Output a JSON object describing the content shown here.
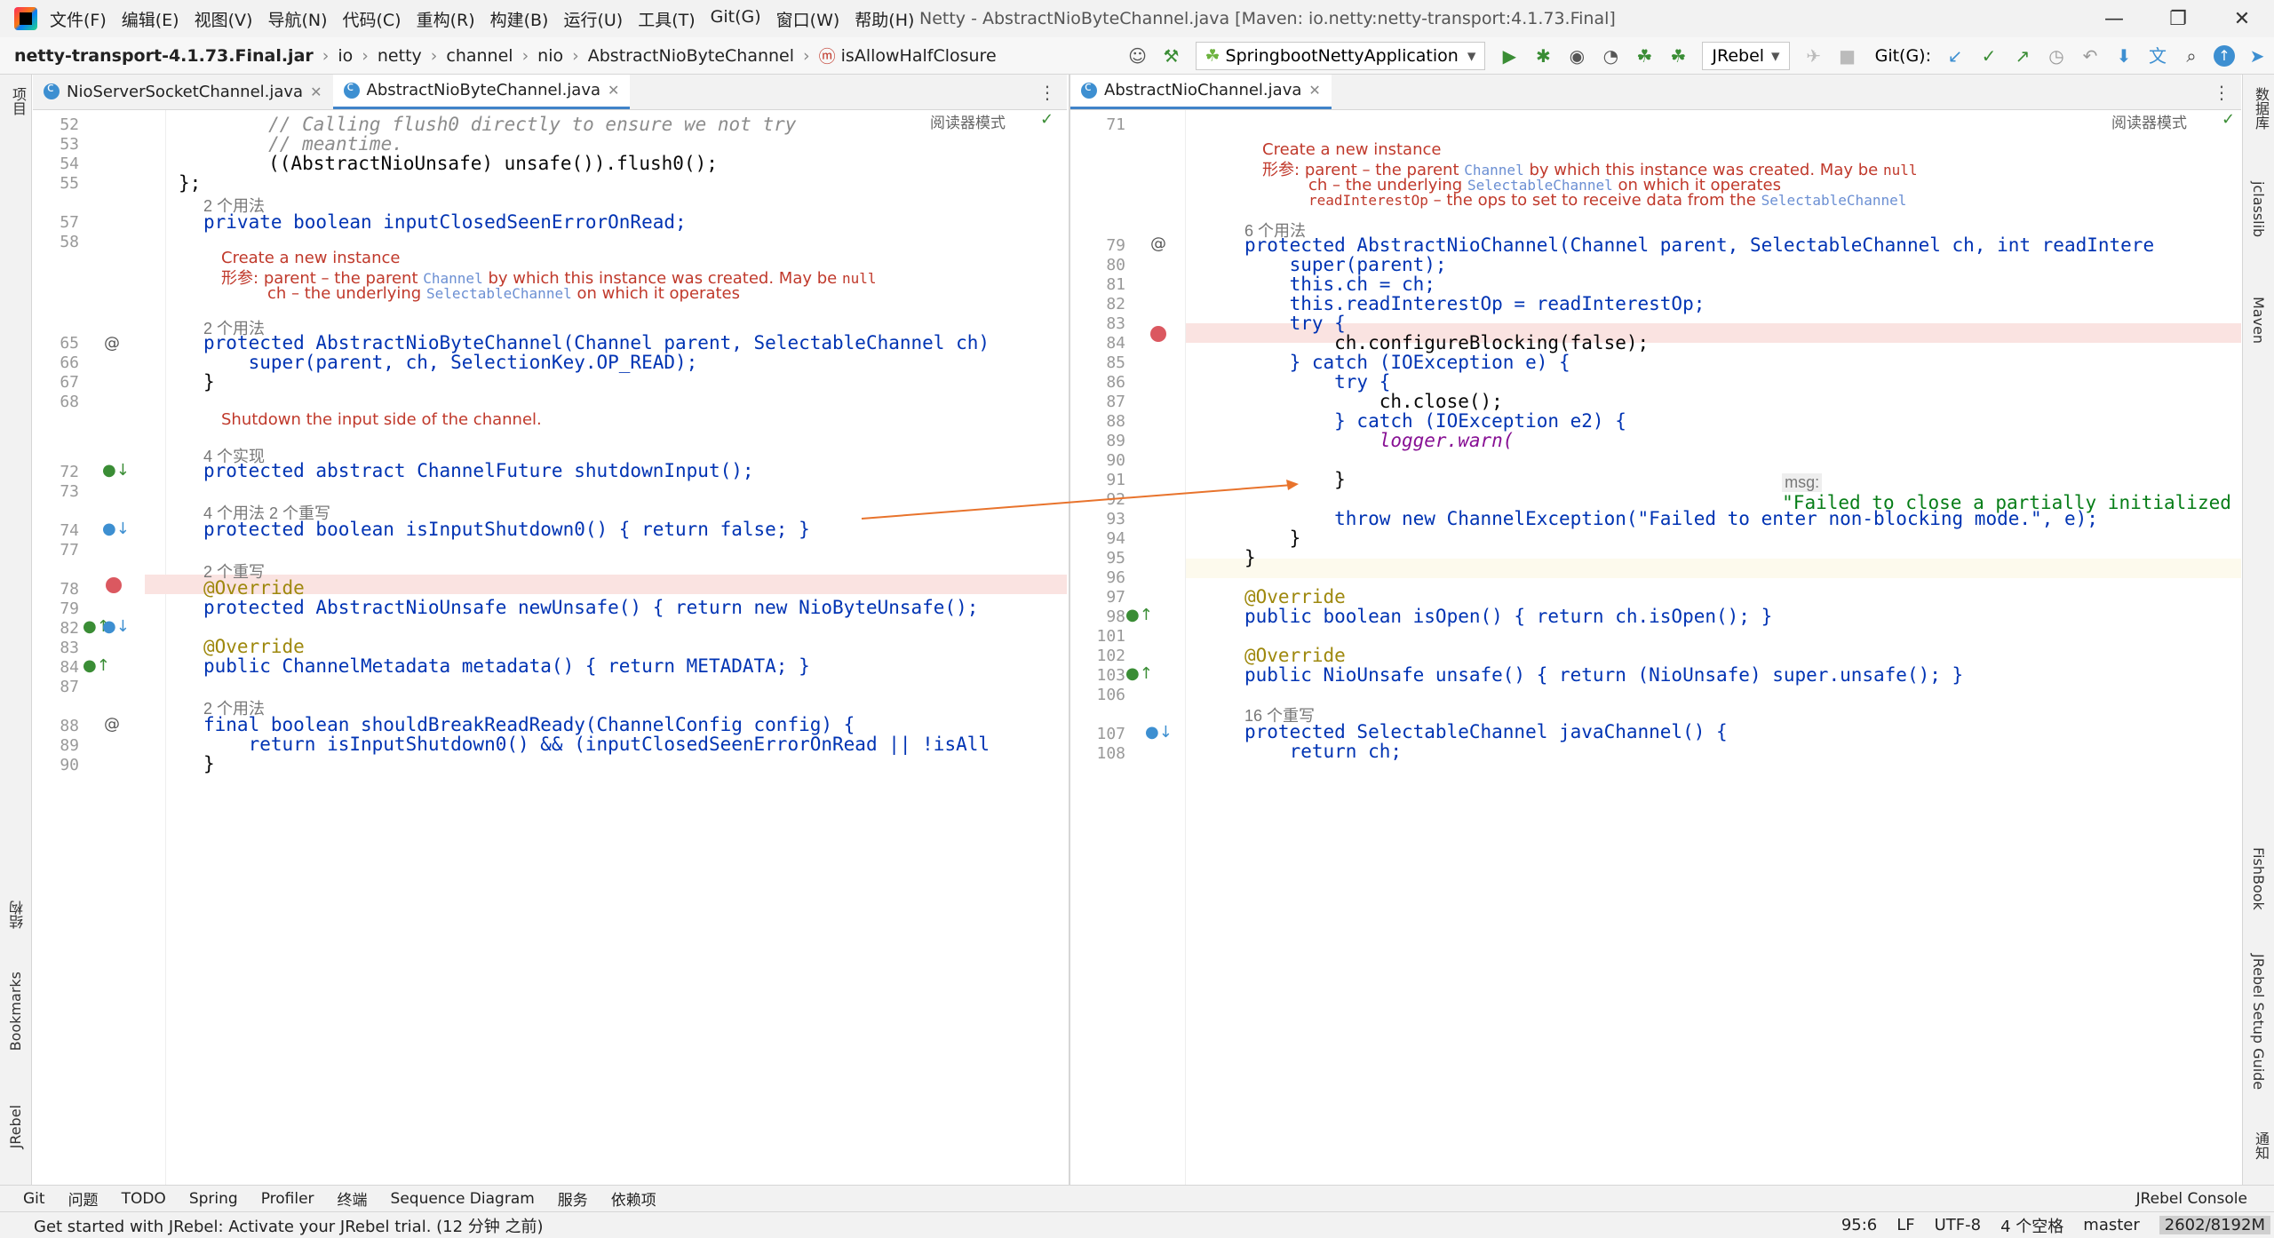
{
  "titlebar": {
    "menus": [
      "文件(F)",
      "编辑(E)",
      "视图(V)",
      "导航(N)",
      "代码(C)",
      "重构(R)",
      "构建(B)",
      "运行(U)",
      "工具(T)",
      "Git(G)",
      "窗口(W)",
      "帮助(H)"
    ],
    "title": "Netty - AbstractNioByteChannel.java [Maven: io.netty:netty-transport:4.1.73.Final]"
  },
  "navbar": {
    "breadcrumb": [
      "netty-transport-4.1.73.Final.jar",
      "io",
      "netty",
      "channel",
      "nio",
      "AbstractNioByteChannel",
      "isAllowHalfClosure"
    ],
    "run_config": "SpringbootNettyApplication",
    "jrebel": "JRebel",
    "git_label": "Git(G):"
  },
  "left_strip": {
    "items": [
      "项目",
      "结构",
      "Bookmarks",
      "JRebel"
    ]
  },
  "right_strip": {
    "items": [
      "数据库",
      "jclasslib",
      "Maven",
      "FishBook",
      "JRebel Setup Guide",
      "通知"
    ]
  },
  "editor_left": {
    "tabs": [
      {
        "label": "NioServerSocketChannel.java",
        "active": false
      },
      {
        "label": "AbstractNioByteChannel.java",
        "active": true
      }
    ],
    "reader_mode": "阅读器模式",
    "line_numbers": [
      "52",
      "53",
      "54",
      "55",
      "57",
      "58",
      "65",
      "66",
      "67",
      "68",
      "72",
      "73",
      "74",
      "77",
      "78",
      "79",
      "82",
      "83",
      "84",
      "87",
      "88",
      "89",
      "90"
    ],
    "code": [
      "        // Calling flush0 directly to ensure we not try",
      "        // meantime.",
      "        ((AbstractNioUnsafe) unsafe()).flush0();",
      "};",
      "private boolean inputClosedSeenErrorOnRead;",
      "protected AbstractNioByteChannel(Channel parent, SelectableChannel ch)",
      "    super(parent, ch, SelectionKey.OP_READ);",
      "}",
      "protected abstract ChannelFuture shutdownInput();",
      "protected boolean isInputShutdown0() { return false; }",
      "@Override",
      "protected AbstractNioUnsafe newUnsafe() { return new NioByteUnsafe();",
      "@Override",
      "public ChannelMetadata metadata() { return METADATA; }",
      "final boolean shouldBreakReadReady(ChannelConfig config) {",
      "    return isInputShutdown0() && (inputClosedSeenErrorOnRead || !isAll",
      "}"
    ],
    "usages": [
      "2 个用法",
      "2 个用法",
      "4 个实现",
      "4 个用法   2 个重写",
      "2 个重写",
      "2 个用法"
    ],
    "doc1": {
      "title": "Create a new instance",
      "param_label": "形参:",
      "p1": "parent – the parent",
      "p1_code": "Channel",
      "p1_tail": "by which this instance was created. May be",
      "p1_null": "null",
      "p2": "ch – the underlying",
      "p2_code": "SelectableChannel",
      "p2_tail": "on which it operates"
    },
    "doc2": {
      "title": "Shutdown the input side of the channel."
    }
  },
  "editor_right": {
    "tabs": [
      {
        "label": "AbstractNioChannel.java",
        "active": true
      }
    ],
    "reader_mode": "阅读器模式",
    "line_numbers": [
      "71",
      "79",
      "80",
      "81",
      "82",
      "83",
      "84",
      "85",
      "86",
      "87",
      "88",
      "89",
      "90",
      "91",
      "92",
      "93",
      "94",
      "95",
      "96",
      "97",
      "98",
      "101",
      "102",
      "103",
      "106",
      "107",
      "108"
    ],
    "code": [
      "protected AbstractNioChannel(Channel parent, SelectableChannel ch, int readIntere",
      "    super(parent);",
      "    this.ch = ch;",
      "    this.readInterestOp = readInterestOp;",
      "    try {",
      "        ch.configureBlocking(false);",
      "    } catch (IOException e) {",
      "        try {",
      "            ch.close();",
      "        } catch (IOException e2) {",
      "            logger.warn(",
      "\"Failed to close a partially initialized socket.\", e",
      "        }",
      "        throw new ChannelException(\"Failed to enter non-blocking mode.\", e);",
      "    }",
      "}",
      "@Override",
      "public boolean isOpen() { return ch.isOpen(); }",
      "@Override",
      "public NioUnsafe unsafe() { return (NioUnsafe) super.unsafe(); }",
      "protected SelectableChannel javaChannel() {",
      "    return ch;"
    ],
    "hint_msg": "msg:",
    "usages": [
      "6 个用法",
      "16 个重写"
    ],
    "doc": {
      "title": "Create a new instance",
      "param_label": "形参:",
      "p1": "parent – the parent",
      "p1_code": "Channel",
      "p1_tail": "by which this instance was created. May be",
      "p1_null": "null",
      "p2": "ch – the underlying",
      "p2_code": "SelectableChannel",
      "p2_tail": "on which it operates",
      "p3_code": "readInterestOp",
      "p3_tail": "– the ops to set to receive data from the",
      "p3_code2": "SelectableChannel"
    }
  },
  "toolwindows": [
    "Git",
    "问题",
    "TODO",
    "Spring",
    "Profiler",
    "终端",
    "Sequence Diagram",
    "服务",
    "依赖项"
  ],
  "toolwindows_right": "JRebel Console",
  "statusbar": {
    "message": "Get started with JRebel: Activate your JRebel trial. (12 分钟 之前)",
    "position": "95:6",
    "line_sep": "LF",
    "encoding": "UTF-8",
    "indent": "4 个空格",
    "branch": "master",
    "memory": "2602/8192M"
  },
  "colors": {
    "breakpoint": "#db5860",
    "keyword": "#0033b3",
    "doc": "#c0392b",
    "string": "#067d17",
    "highlight": "#fae3e1",
    "arrow": "#e8732c"
  }
}
